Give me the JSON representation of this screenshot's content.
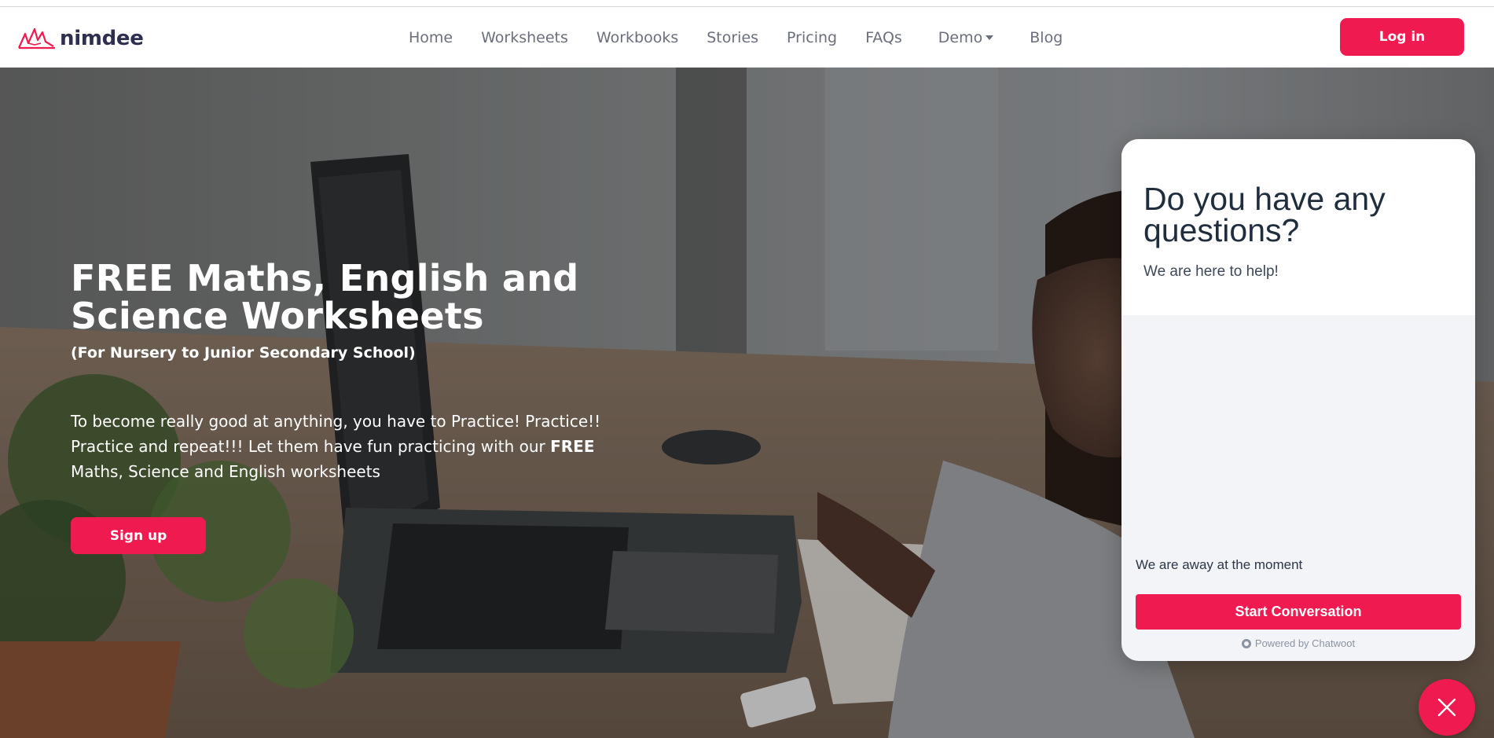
{
  "brand": {
    "name": "nimdee",
    "accent": "#ef1a4f"
  },
  "nav": {
    "items": [
      {
        "label": "Home"
      },
      {
        "label": "Worksheets"
      },
      {
        "label": "Workbooks"
      },
      {
        "label": "Stories"
      },
      {
        "label": "Pricing"
      },
      {
        "label": "FAQs"
      },
      {
        "label": "Demo",
        "dropdown": true
      },
      {
        "label": "Blog"
      }
    ],
    "login_label": "Log in"
  },
  "hero": {
    "title_line1": "FREE Maths, English and",
    "title_line2": "Science Worksheets",
    "subtitle": "(For Nursery to Junior Secondary School)",
    "text_part1": "To become really good at anything, you have to Practice! Practice!! Practice and repeat!!! Let them have fun practicing with our ",
    "text_bold": "FREE",
    "text_part2": "Maths, Science and English worksheets",
    "signup_label": "Sign up"
  },
  "chat": {
    "title": "Do you have any questions?",
    "tagline": "We are here to help!",
    "status": "We are away at the moment",
    "start_label": "Start Conversation",
    "powered_by": "Powered by Chatwoot"
  }
}
